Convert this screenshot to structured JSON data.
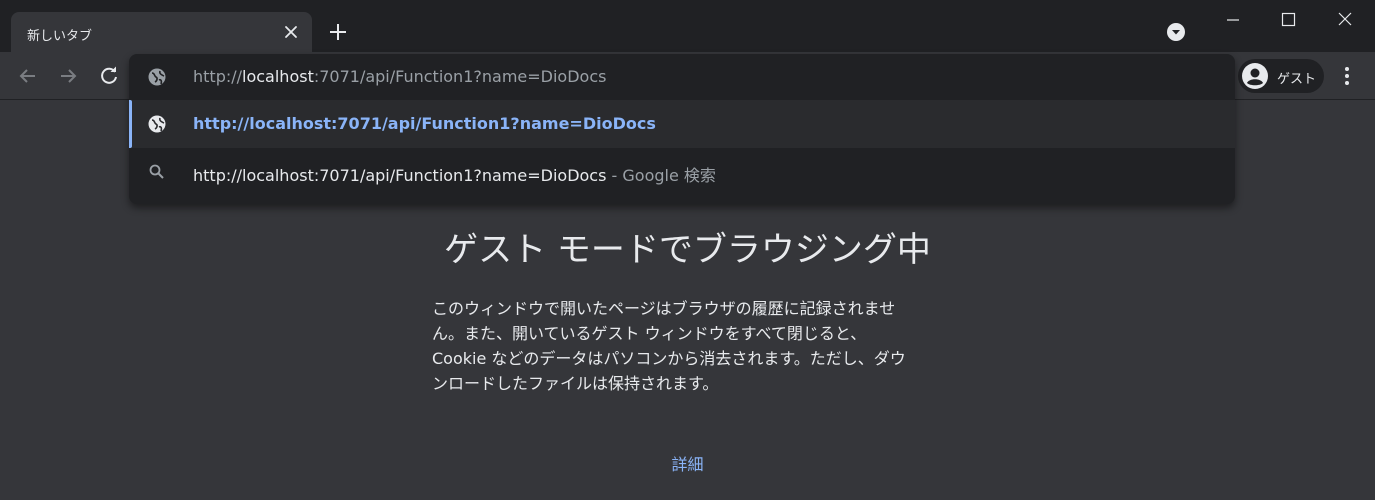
{
  "tab": {
    "title": "新しいタブ",
    "close_icon": "close-icon",
    "new_tab_icon": "plus-icon",
    "tab_search_icon": "chevron-down-icon"
  },
  "window_controls": [
    "minimize-icon",
    "maximize-icon",
    "close-icon"
  ],
  "toolbar": {
    "back_icon": "arrow-left-icon",
    "forward_icon": "arrow-right-icon",
    "reload_icon": "reload-icon",
    "profile_label": "ゲスト",
    "menu_icon": "more-vertical-icon"
  },
  "omnibox": {
    "input_prefix": "http://",
    "input_host": "localhost",
    "input_rest": ":7071/api/Function1?name=DioDocs",
    "suggestions": [
      {
        "icon": "globe-icon",
        "text": "http://localhost:7071/api/Function1?name=DioDocs",
        "suffix": "",
        "selected": true
      },
      {
        "icon": "search-icon",
        "text": "http://localhost:7071/api/Function1?name=DioDocs",
        "suffix": " - Google 検索",
        "selected": false
      }
    ]
  },
  "page": {
    "title": "ゲスト モードでブラウジング中",
    "body_lines": [
      "このウィンドウで開いたページはブラウザの履歴に記録されませ",
      "ん。また、開いているゲスト ウィンドウをすべて閉じると、",
      "Cookie などのデータはパソコンから消去されます。ただし、ダウ",
      "ンロードしたファイルは保持されます。"
    ],
    "learn_more": "詳細"
  },
  "colors": {
    "frame": "#202124",
    "toolbar": "#35363a",
    "text": "#e8eaed",
    "muted": "#9aa0a6",
    "accent": "#8ab4f8"
  }
}
